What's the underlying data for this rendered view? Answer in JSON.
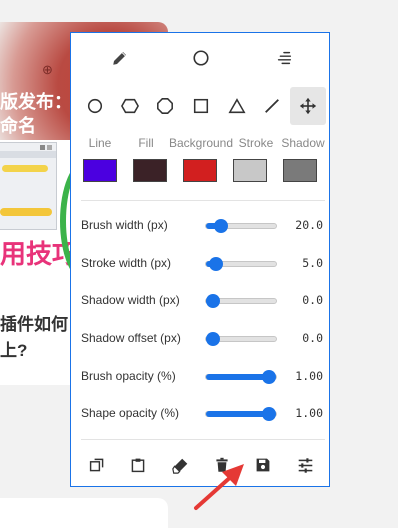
{
  "background": {
    "headline": [
      "版发布：",
      "命名"
    ],
    "pink_text": "用技巧",
    "lower_text": [
      "插件如何",
      "上?"
    ],
    "zoom_glyph": "⊕"
  },
  "panel": {
    "modes": [
      "pencil-icon",
      "circle-mode-icon",
      "spray-icon"
    ],
    "shapes": [
      "circle-shape-icon",
      "hexagon-icon",
      "octagon-icon",
      "square-icon",
      "triangle-icon",
      "line-icon",
      "move-icon"
    ],
    "active_shape": "move-icon",
    "colors": [
      {
        "label": "Line",
        "hex": "#4b00e0"
      },
      {
        "label": "Fill",
        "hex": "#3b2227"
      },
      {
        "label": "Background",
        "hex": "#d21f1f"
      },
      {
        "label": "Stroke",
        "hex": "#c8c8c8"
      },
      {
        "label": "Shadow",
        "hex": "#7a7a7a"
      }
    ],
    "sliders": [
      {
        "label": "Brush width (px)",
        "value": "20.0",
        "fraction": 0.15
      },
      {
        "label": "Stroke width (px)",
        "value": "5.0",
        "fraction": 0.05
      },
      {
        "label": "Shadow width (px)",
        "value": "0.0",
        "fraction": 0.0
      },
      {
        "label": "Shadow offset (px)",
        "value": "0.0",
        "fraction": 0.0
      },
      {
        "label": "Brush opacity (%)",
        "value": "1.00",
        "fraction": 1.0
      },
      {
        "label": "Shape opacity (%)",
        "value": "1.00",
        "fraction": 1.0
      }
    ],
    "actions": [
      "copy-icon",
      "clipboard-icon",
      "eraser-icon",
      "trash-icon",
      "save-icon",
      "settings-sliders-icon"
    ],
    "accent": "#1a73e8"
  },
  "annotation": {
    "arrow_color": "#e53935"
  }
}
